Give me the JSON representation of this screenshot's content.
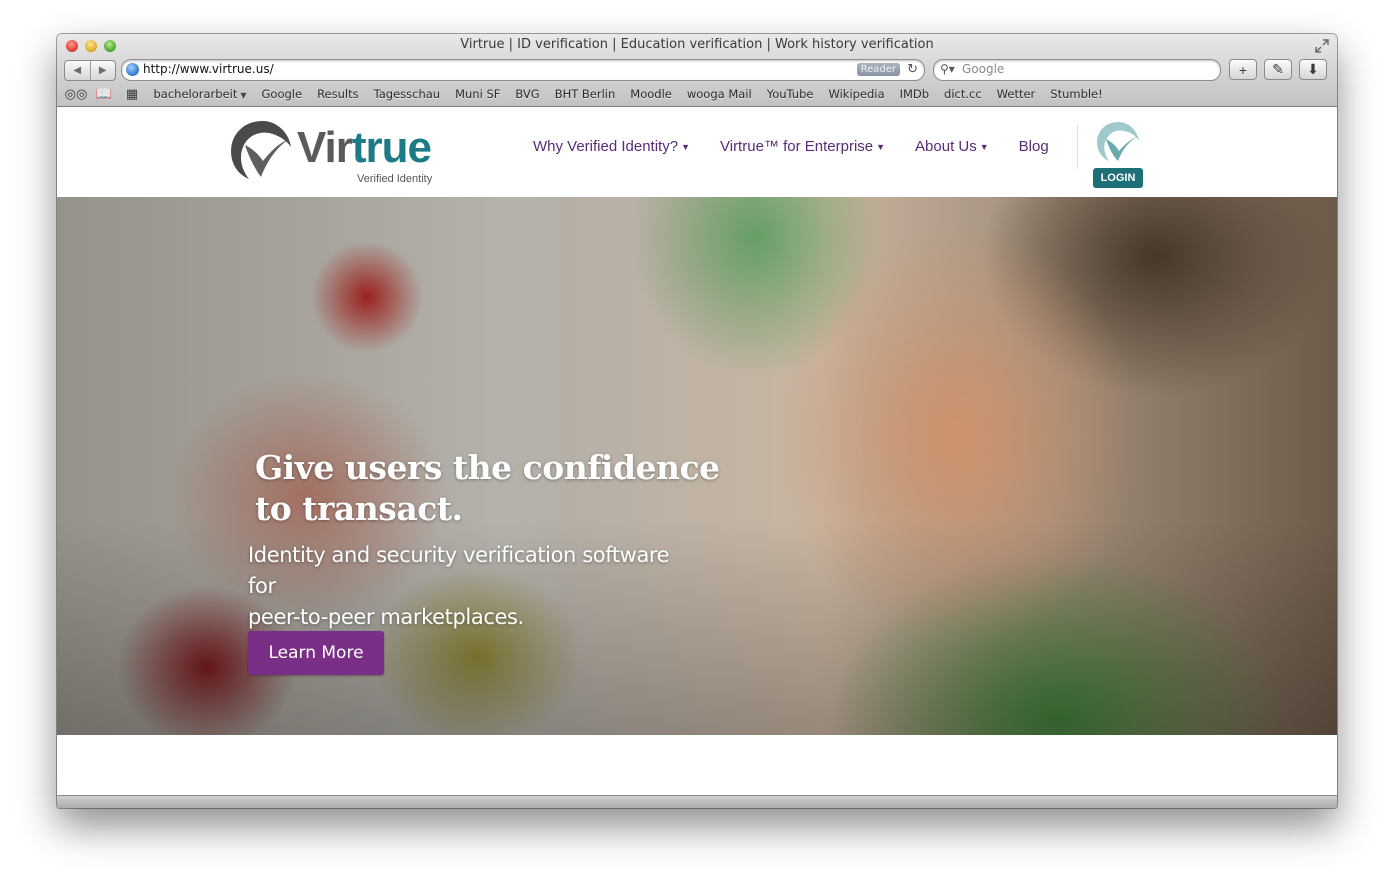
{
  "window": {
    "title": "Virtrue | ID verification | Education verification | Work history verification"
  },
  "toolbar": {
    "url": "http://www.virtrue.us/",
    "reader_label": "Reader",
    "search_placeholder": "Google"
  },
  "bookmarks": [
    {
      "label": "bachelorarbeit",
      "has_dropdown": true
    },
    {
      "label": "Google"
    },
    {
      "label": "Results"
    },
    {
      "label": "Tagesschau"
    },
    {
      "label": "Muni SF"
    },
    {
      "label": "BVG"
    },
    {
      "label": "BHT Berlin"
    },
    {
      "label": "Moodle"
    },
    {
      "label": "wooga Mail"
    },
    {
      "label": "YouTube"
    },
    {
      "label": "Wikipedia"
    },
    {
      "label": "IMDb"
    },
    {
      "label": "dict.cc"
    },
    {
      "label": "Wetter"
    },
    {
      "label": "Stumble!"
    }
  ],
  "site": {
    "logo": {
      "vir": "Vir",
      "true": "true",
      "tagline": "Verified Identity"
    },
    "nav": [
      {
        "label": "Why Verified Identity?",
        "has_dropdown": true
      },
      {
        "label": "Virtrue™ for Enterprise",
        "has_dropdown": true
      },
      {
        "label": "About Us",
        "has_dropdown": true
      },
      {
        "label": "Blog",
        "has_dropdown": false
      }
    ],
    "login_label": "LOGIN",
    "hero": {
      "title_line1": "Give users the confidence",
      "title_line2": "to transact.",
      "subtitle_line1": "Identity and security verification software for",
      "subtitle_line2": "peer-to-peer marketplaces.",
      "cta_label": "Learn More"
    }
  },
  "colors": {
    "brand_purple": "#7a2f86",
    "nav_purple": "#5a2b78",
    "brand_teal": "#1c7b86"
  }
}
